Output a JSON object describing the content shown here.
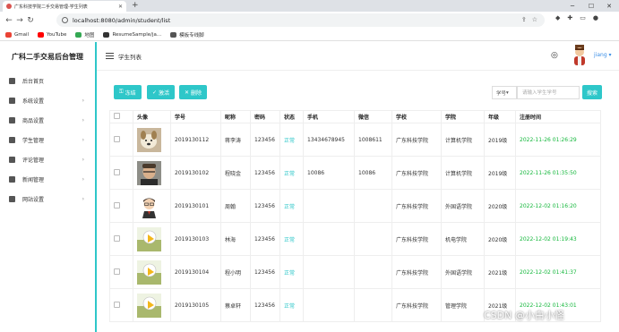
{
  "browser": {
    "tab_title": "广东科技学院二手交易管理-学生列表",
    "url": "localhost:8080/admin/student/list",
    "bookmarks": [
      {
        "label": "Gmail",
        "color": "#ea4335"
      },
      {
        "label": "YouTube",
        "color": "#ff0000"
      },
      {
        "label": "地图",
        "color": "#34a853"
      },
      {
        "label": "ResumeSample/ja...",
        "color": "#333333"
      },
      {
        "label": "模板专线脚",
        "color": "#555555"
      }
    ]
  },
  "sidebar": {
    "brand": "广科二手交易后台管理",
    "items": [
      {
        "label": "后台首页",
        "icon": "home-icon"
      },
      {
        "label": "系统设置",
        "icon": "gear-icon"
      },
      {
        "label": "商品设置",
        "icon": "bag-icon"
      },
      {
        "label": "学生管理",
        "icon": "users-icon"
      },
      {
        "label": "评论管理",
        "icon": "comment-icon"
      },
      {
        "label": "新闻管理",
        "icon": "news-icon"
      },
      {
        "label": "网站设置",
        "icon": "gear-icon"
      }
    ]
  },
  "header": {
    "page_title": "学生列表",
    "username": "jiang"
  },
  "actions": {
    "freeze": "冻结",
    "activate": "激活",
    "delete": "删除"
  },
  "search": {
    "field": "学号",
    "placeholder": "请输入学生学号",
    "button": "搜索"
  },
  "table": {
    "columns": [
      "头像",
      "学号",
      "昵称",
      "密码",
      "状态",
      "手机",
      "微信",
      "学校",
      "学院",
      "年级",
      "注册时间"
    ],
    "rows": [
      {
        "avatar": "dog",
        "id": "2019130112",
        "nickname": "蒋李涛",
        "password": "123456",
        "status": "正常",
        "phone": "13434678945",
        "wechat": "1008611",
        "school": "广东科技学院",
        "college": "计算机学院",
        "grade": "2019级",
        "time": "2022-11-26 01:26:29"
      },
      {
        "avatar": "man",
        "id": "2019130102",
        "nickname": "程晓金",
        "password": "123456",
        "status": "正常",
        "phone": "10086",
        "wechat": "10086",
        "school": "广东科技学院",
        "college": "计算机学院",
        "grade": "2019级",
        "time": "2022-11-26 01:35:50"
      },
      {
        "avatar": "cartoon",
        "id": "2019130101",
        "nickname": "周翰",
        "password": "123456",
        "status": "正常",
        "phone": "",
        "wechat": "",
        "school": "广东科技学院",
        "college": "外国语学院",
        "grade": "2020级",
        "time": "2022-12-02 01:16:20"
      },
      {
        "avatar": "default",
        "id": "2019130103",
        "nickname": "林海",
        "password": "123456",
        "status": "正常",
        "phone": "",
        "wechat": "",
        "school": "广东科技学院",
        "college": "机电学院",
        "grade": "2020级",
        "time": "2022-12-02 01:19:43"
      },
      {
        "avatar": "default",
        "id": "2019130104",
        "nickname": "程小明",
        "password": "123456",
        "status": "正常",
        "phone": "",
        "wechat": "",
        "school": "广东科技学院",
        "college": "外国语学院",
        "grade": "2021级",
        "time": "2022-12-02 01:41:37"
      },
      {
        "avatar": "default",
        "id": "2019130105",
        "nickname": "蔡卓轩",
        "password": "123456",
        "status": "正常",
        "phone": "",
        "wechat": "",
        "school": "广东科技学院",
        "college": "管理学院",
        "grade": "2021级",
        "time": "2022-12-02 01:43:01"
      }
    ]
  },
  "watermark": "CSDN @小白小怪",
  "colors": {
    "accent": "#2ec7c9",
    "time": "#13b73b",
    "user": "#3a8ee6"
  }
}
